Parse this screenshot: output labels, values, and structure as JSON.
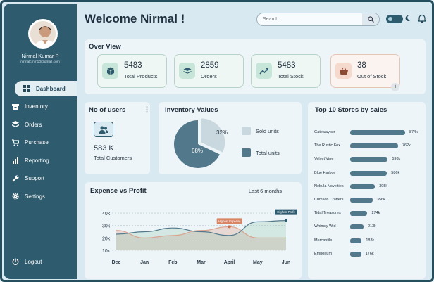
{
  "header": {
    "title": "Welcome Nirmal !",
    "search_placeholder": "Search"
  },
  "user": {
    "name": "Nirmal Kumar P",
    "email": "nirmalcmm10@gmail.com"
  },
  "nav": [
    {
      "label": "Dashboard",
      "icon": "dashboard-icon",
      "active": true
    },
    {
      "label": "Inventory",
      "icon": "inventory-icon"
    },
    {
      "label": "Orders",
      "icon": "orders-icon"
    },
    {
      "label": "Purchase",
      "icon": "cart-icon"
    },
    {
      "label": "Reporting",
      "icon": "reporting-icon"
    },
    {
      "label": "Support",
      "icon": "wrench-icon"
    },
    {
      "label": "Settings",
      "icon": "gear-icon"
    }
  ],
  "logout": "Logout",
  "overview": {
    "title": "Over View",
    "stats": [
      {
        "value": "5483",
        "label": "Total Products",
        "icon": "box-icon"
      },
      {
        "value": "2859",
        "label": "Orders",
        "icon": "layers-icon"
      },
      {
        "value": "5483",
        "label": "Total Stock",
        "icon": "trend-icon"
      },
      {
        "value": "38",
        "label": "Out of Stock",
        "icon": "basket-icon"
      }
    ],
    "info": "i"
  },
  "users": {
    "title": "No of users",
    "value": "583 K",
    "label": "Total Customers"
  },
  "inventory": {
    "title": "Inventory Values",
    "sold_pct": "32%",
    "total_pct": "68%",
    "legend_sold": "Sold units",
    "legend_total": "Total units"
  },
  "expense": {
    "title": "Expense vs Profit",
    "range": "Last 6 months",
    "tag_expense": "Highest Expense",
    "tag_profit": "Highest Profit"
  },
  "top_stores": {
    "title": "Top 10 Stores by sales"
  },
  "colors": {
    "accent": "#2e5b6e",
    "profit": "#52788b",
    "expense": "#d9a48f"
  },
  "chart_data": [
    {
      "type": "pie",
      "title": "Inventory Values",
      "categories": [
        "Sold units",
        "Total units"
      ],
      "values": [
        32,
        68
      ]
    },
    {
      "type": "area",
      "title": "Expense vs Profit",
      "categories": [
        "Dec",
        "Jan",
        "Feb",
        "Mar",
        "April",
        "May",
        "Jun"
      ],
      "yticks": [
        "40k",
        "30k",
        "20k",
        "10k"
      ],
      "ylim": [
        10,
        40
      ],
      "series": [
        {
          "name": "Expense",
          "values": [
            26,
            20,
            22,
            26,
            29,
            20,
            20
          ]
        },
        {
          "name": "Profit",
          "values": [
            23,
            25,
            28,
            25,
            22,
            33,
            34
          ]
        }
      ]
    },
    {
      "type": "bar",
      "title": "Top 10 Stores by sales",
      "categories": [
        "Gateway str",
        "The Rustic Fox",
        "Velvet Vine",
        "Blue Harbor",
        "Nebula Novelties",
        "Crimson Crafters",
        "Tidal Treasures",
        "Whimsy Wid",
        "Mercantile",
        "Emporium"
      ],
      "values": [
        874,
        762,
        598,
        586,
        395,
        356,
        274,
        213,
        183,
        176
      ],
      "labels": [
        "874k",
        "762k",
        "598k",
        "586k",
        "395k",
        "356k",
        "274k",
        "213k",
        "183k",
        "176k"
      ]
    }
  ]
}
